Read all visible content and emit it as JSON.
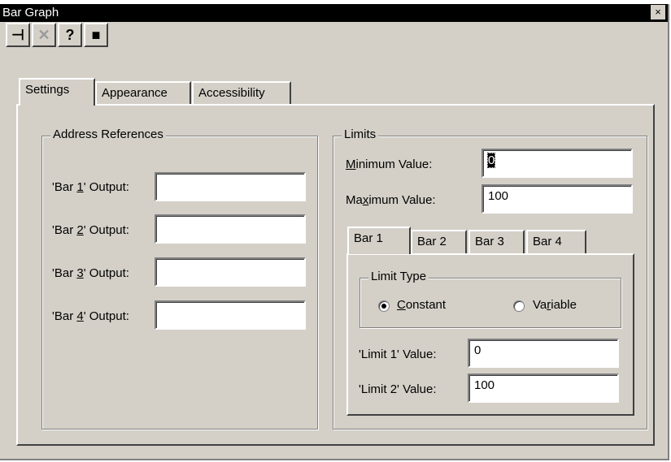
{
  "window": {
    "title": "Bar Graph",
    "close_glyph": "×"
  },
  "toolbar": [
    {
      "icon": "pin-icon",
      "glyph": "⊣"
    },
    {
      "icon": "delete-icon",
      "glyph": "✕"
    },
    {
      "icon": "help-icon",
      "glyph": "?"
    },
    {
      "icon": "properties-icon",
      "glyph": "■"
    }
  ],
  "tabs": [
    "Settings",
    "Appearance",
    "Accessibility"
  ],
  "address_references": {
    "legend": "Address References",
    "rows": [
      {
        "pre": "'Bar ",
        "key": "1",
        "post": "' Output:",
        "value": ""
      },
      {
        "pre": "'Bar ",
        "key": "2",
        "post": "' Output:",
        "value": ""
      },
      {
        "pre": "'Bar ",
        "key": "3",
        "post": "' Output:",
        "value": ""
      },
      {
        "pre": "'Bar ",
        "key": "4",
        "post": "' Output:",
        "value": ""
      }
    ]
  },
  "limits": {
    "legend": "Limits",
    "minimum": {
      "key": "M",
      "rest": "inimum Value:",
      "value": "0"
    },
    "maximum": {
      "pre": "Ma",
      "key": "x",
      "rest": "imum Value:",
      "value": "100"
    },
    "bar_tabs": [
      "Bar 1",
      "Bar 2",
      "Bar 3",
      "Bar 4"
    ],
    "limit_type": {
      "legend": "Limit Type",
      "constant": {
        "key": "C",
        "rest": "onstant",
        "selected": true
      },
      "variable": {
        "pre": "Va",
        "key": "r",
        "rest": "iable",
        "selected": false
      }
    },
    "limit1": {
      "label": "'Limit 1' Value:",
      "value": "0"
    },
    "limit2": {
      "label": "'Limit 2' Value:",
      "value": "100"
    }
  }
}
